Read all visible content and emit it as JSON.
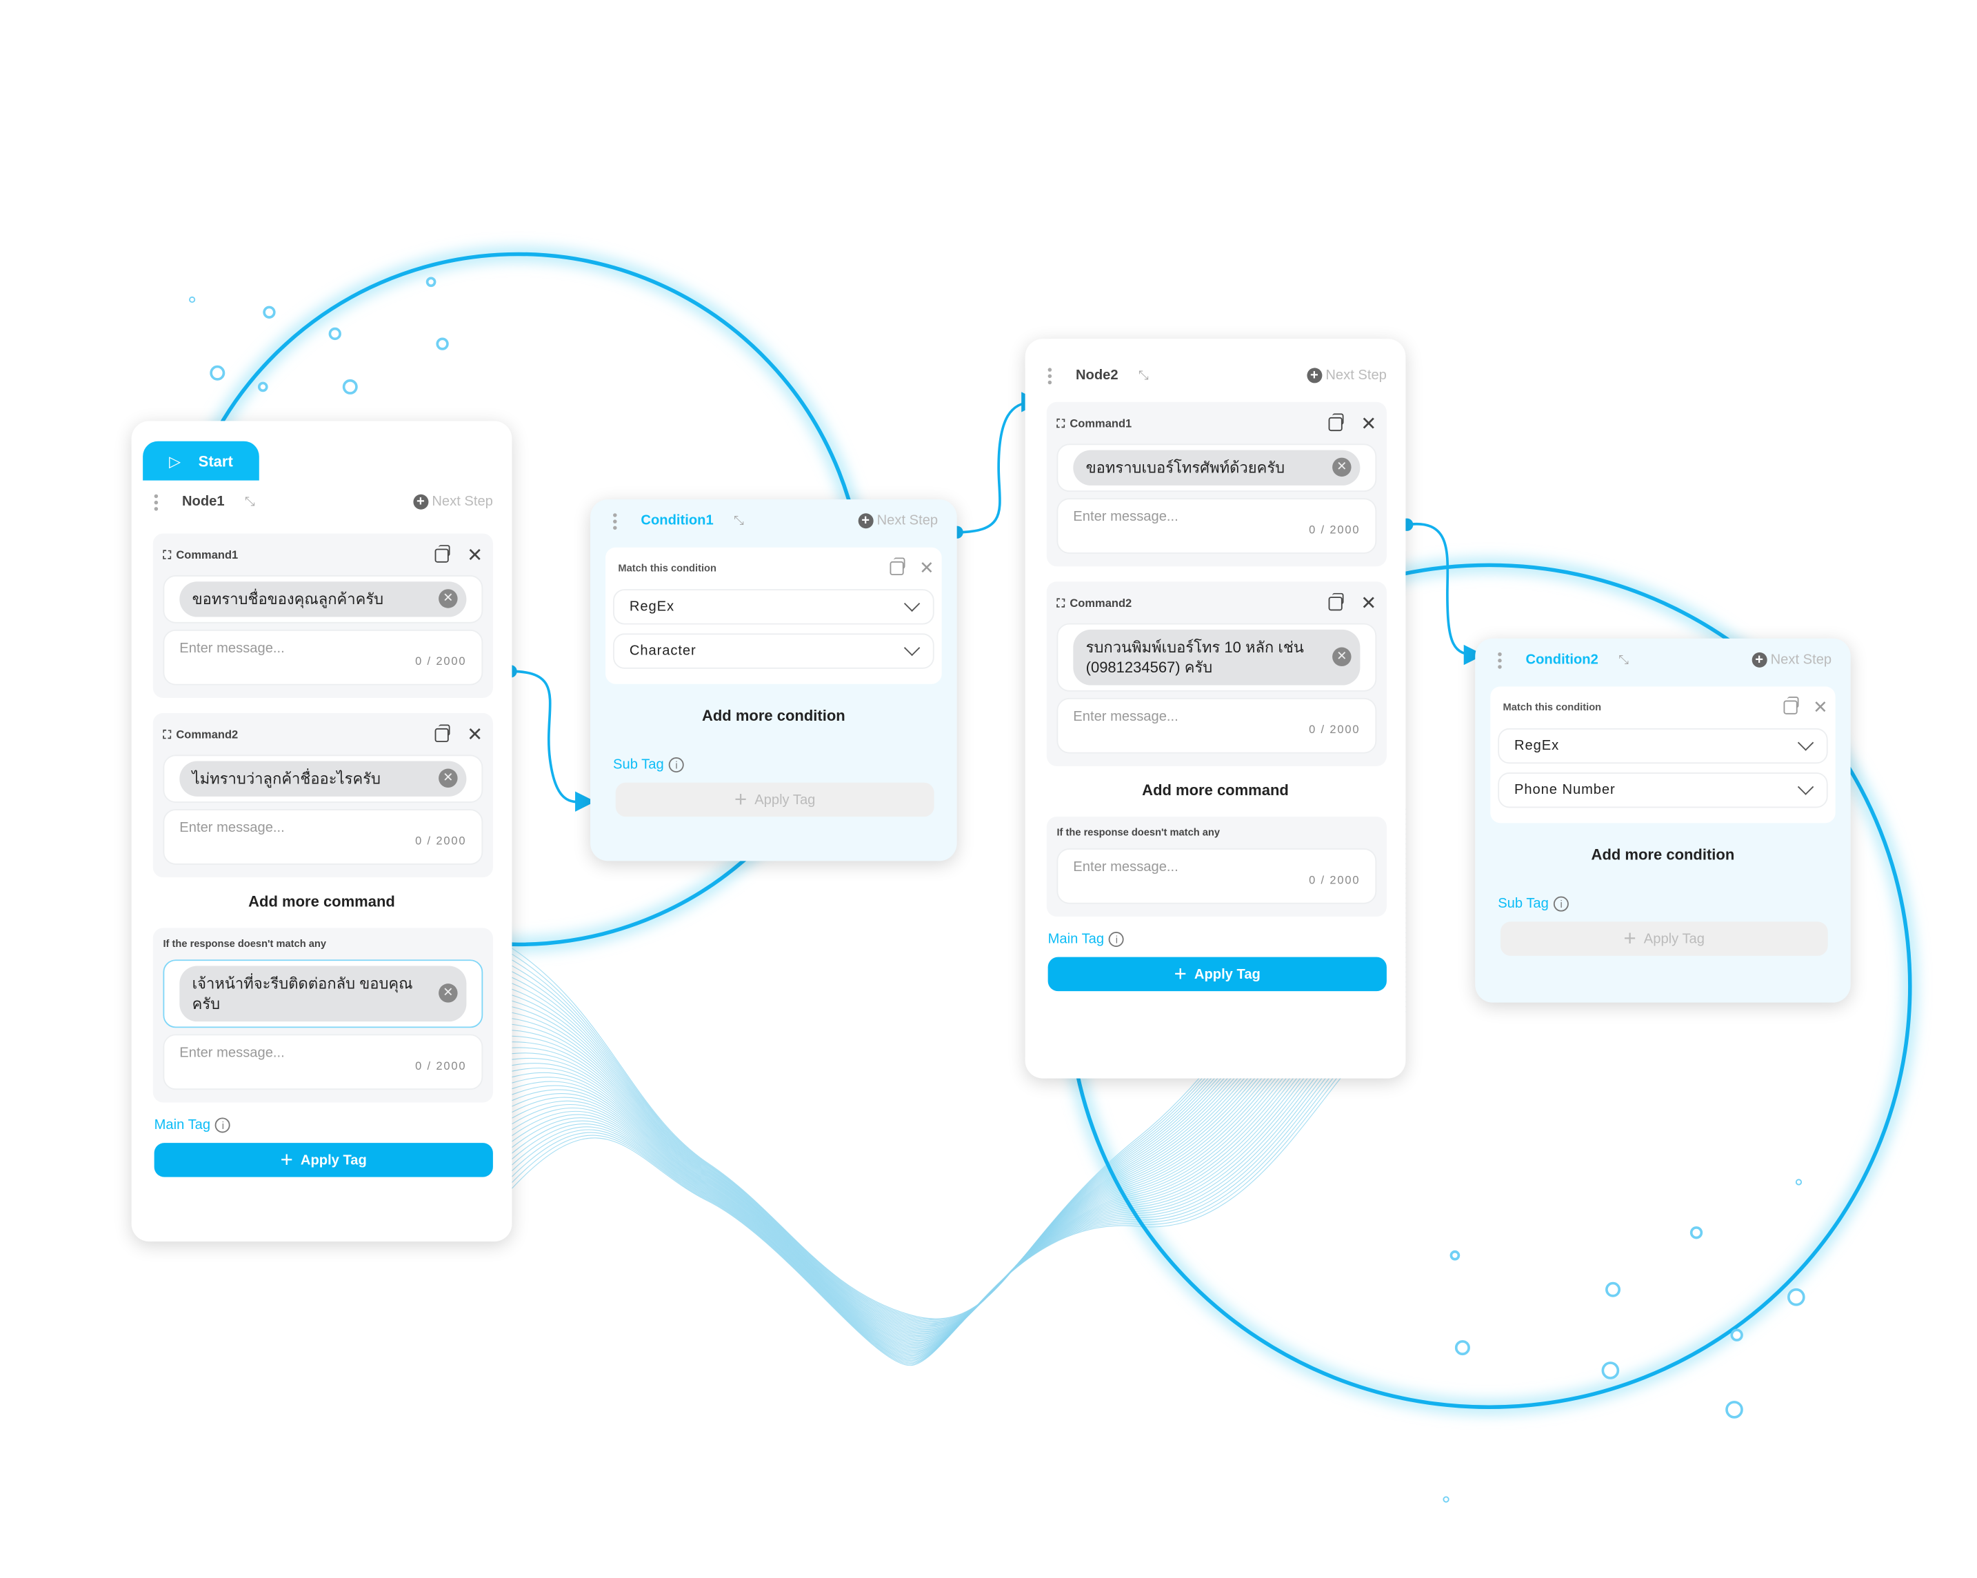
{
  "colors": {
    "accent": "#0cbcf6",
    "button": "#05b3f1",
    "ring": "#12b0ee",
    "wave": "#8fd4ef"
  },
  "nodes": [
    {
      "start_label": "Start",
      "title": "Node1",
      "next_step": "Next Step",
      "commands": [
        {
          "title": "Command1",
          "chip": "ขอทราบชื่อของคุณลูกค้าครับ",
          "placeholder": "Enter message...",
          "counter": "0 / 2000"
        },
        {
          "title": "Command2",
          "chip": "ไม่ทราบว่าลูกค้าชื่ออะไรครับ",
          "placeholder": "Enter message...",
          "counter": "0 / 2000"
        }
      ],
      "add_more": "Add more command",
      "fallback": {
        "label": "If the response doesn't match any",
        "chip": "เจ้าหน้าที่จะรีบติดต่อกลับ ขอบคุณครับ",
        "placeholder": "Enter message...",
        "counter": "0 / 2000"
      },
      "tag_label": "Main Tag",
      "apply_label": "Apply Tag"
    },
    {
      "title": "Node2",
      "next_step": "Next Step",
      "commands": [
        {
          "title": "Command1",
          "chip": "ขอทราบเบอร์โทรศัพท์ด้วยครับ",
          "placeholder": "Enter message...",
          "counter": "0 / 2000"
        },
        {
          "title": "Command2",
          "chip": "รบกวนพิมพ์เบอร์โทร 10 หลัก เช่น (0981234567) ครับ",
          "placeholder": "Enter message...",
          "counter": "0 / 2000"
        }
      ],
      "add_more": "Add more command",
      "fallback": {
        "label": "If the response doesn't match any",
        "placeholder": "Enter message...",
        "counter": "0 / 2000"
      },
      "tag_label": "Main Tag",
      "apply_label": "Apply Tag"
    }
  ],
  "conditions": [
    {
      "title": "Condition1",
      "next_step": "Next Step",
      "match_label": "Match this condition",
      "selects": [
        "RegEx",
        "Character"
      ],
      "add_more": "Add more condition",
      "tag_label": "Sub Tag",
      "apply_label": "Apply Tag"
    },
    {
      "title": "Condition2",
      "next_step": "Next Step",
      "match_label": "Match this condition",
      "selects": [
        "RegEx",
        "Phone Number"
      ],
      "add_more": "Add more condition",
      "tag_label": "Sub Tag",
      "apply_label": "Apply Tag"
    }
  ]
}
